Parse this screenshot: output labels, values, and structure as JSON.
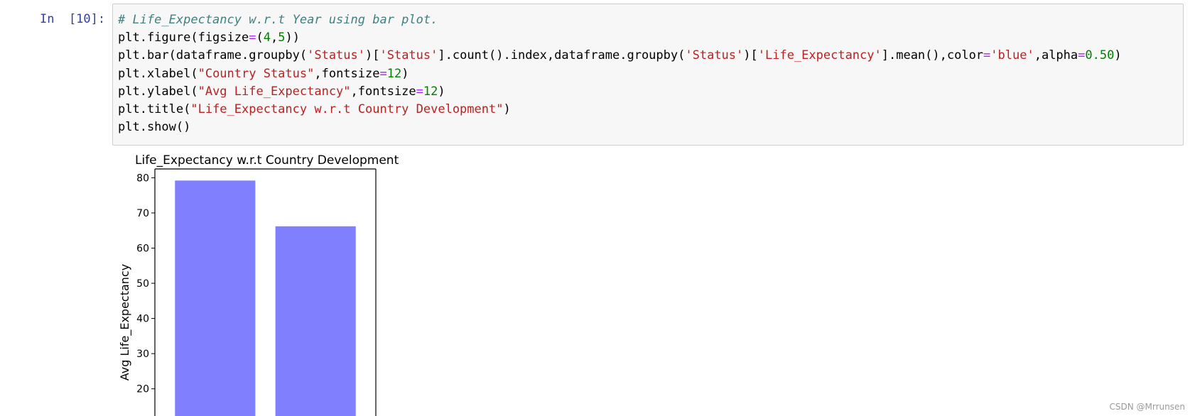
{
  "cell": {
    "prompt": "In  [10]:",
    "code_lines": [
      [
        {
          "t": "# Life_Expectancy w.r.t Year using bar plot.",
          "c": "cm"
        }
      ],
      [
        {
          "t": "plt.figure(figsize"
        },
        {
          "t": "=",
          "c": "op"
        },
        {
          "t": "("
        },
        {
          "t": "4",
          "c": "num"
        },
        {
          "t": ","
        },
        {
          "t": "5",
          "c": "num"
        },
        {
          "t": "))"
        }
      ],
      [
        {
          "t": "plt.bar(dataframe.groupby("
        },
        {
          "t": "'Status'",
          "c": "str"
        },
        {
          "t": ")["
        },
        {
          "t": "'Status'",
          "c": "str"
        },
        {
          "t": "].count().index,dataframe.groupby("
        },
        {
          "t": "'Status'",
          "c": "str"
        },
        {
          "t": ")["
        },
        {
          "t": "'Life_Expectancy'",
          "c": "str"
        },
        {
          "t": "].mean(),color"
        },
        {
          "t": "=",
          "c": "op"
        },
        {
          "t": "'blue'",
          "c": "str"
        },
        {
          "t": ",alpha"
        },
        {
          "t": "=",
          "c": "op"
        },
        {
          "t": "0.50",
          "c": "num"
        },
        {
          "t": ")"
        }
      ],
      [
        {
          "t": "plt.xlabel("
        },
        {
          "t": "\"Country Status\"",
          "c": "str"
        },
        {
          "t": ",fontsize"
        },
        {
          "t": "=",
          "c": "op"
        },
        {
          "t": "12",
          "c": "num"
        },
        {
          "t": ")"
        }
      ],
      [
        {
          "t": "plt.ylabel("
        },
        {
          "t": "\"Avg Life_Expectancy\"",
          "c": "str"
        },
        {
          "t": ",fontsize"
        },
        {
          "t": "=",
          "c": "op"
        },
        {
          "t": "12",
          "c": "num"
        },
        {
          "t": ")"
        }
      ],
      [
        {
          "t": "plt.title("
        },
        {
          "t": "\"Life_Expectancy w.r.t Country Development\"",
          "c": "str"
        },
        {
          "t": ")"
        }
      ],
      [
        {
          "t": "plt.show()"
        }
      ]
    ]
  },
  "chart_data": {
    "type": "bar",
    "title": "Life_Expectancy w.r.t Country Development",
    "xlabel": "",
    "ylabel": "Avg Life_Expectancy",
    "categories": [
      "",
      ""
    ],
    "values": [
      79.2,
      66.2
    ],
    "color": "#8080ff",
    "yticks": [
      20,
      30,
      40,
      50,
      60,
      70,
      80
    ],
    "ylim_visible": [
      15.5,
      82.5
    ],
    "grid": false
  },
  "watermark": "CSDN @Mrrunsen"
}
